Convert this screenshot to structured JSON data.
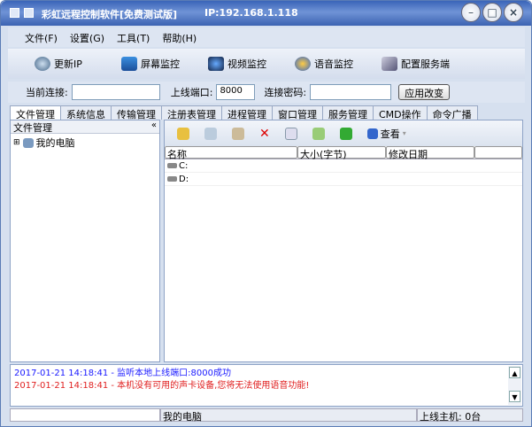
{
  "window": {
    "title": "彩虹远程控制软件[免费测试版]",
    "ip": "IP:192.168.1.118"
  },
  "menu": [
    "文件(F)",
    "设置(G)",
    "工具(T)",
    "帮助(H)"
  ],
  "toolbar": [
    "更新IP",
    "屏幕监控",
    "视频监控",
    "语音监控",
    "配置服务端"
  ],
  "connection": {
    "current_label": "当前连接:",
    "current_value": "",
    "port_label": "上线端口:",
    "port_value": "8000",
    "password_label": "连接密码:",
    "password_value": "",
    "apply_label": "应用改变"
  },
  "tabs": [
    "文件管理",
    "系统信息",
    "传输管理",
    "注册表管理",
    "进程管理",
    "窗口管理",
    "服务管理",
    "CMD操作",
    "命令广播"
  ],
  "left": {
    "title": "文件管理",
    "collapse": "«",
    "tree_item": "我的电脑",
    "expand": "⊞"
  },
  "files": {
    "view_label": "查看",
    "columns": [
      "名称",
      "大小(字节)",
      "修改日期"
    ],
    "rows": [
      "C:",
      "D:"
    ]
  },
  "log": [
    {
      "text": "2017-01-21 14:18:41 - 监听本地上线端口:8000成功",
      "color": "#1a1aff"
    },
    {
      "text": "2017-01-21 14:18:41 - 本机没有可用的声卡设备,您将无法使用语音功能!",
      "color": "#e02020"
    }
  ],
  "status": {
    "path": "我的电脑",
    "online": "上线主机: 0台"
  }
}
